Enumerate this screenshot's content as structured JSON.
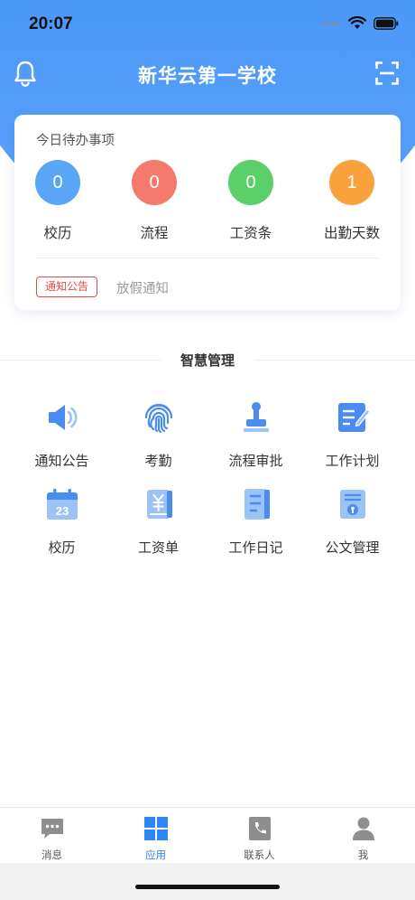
{
  "status_bar": {
    "time": "20:07"
  },
  "header": {
    "title": "新华云第一学校"
  },
  "todo": {
    "title": "今日待办事项",
    "items": [
      {
        "label": "校历",
        "count": "0",
        "color": "#5aa6f6"
      },
      {
        "label": "流程",
        "count": "0",
        "color": "#f57a6e"
      },
      {
        "label": "工资条",
        "count": "0",
        "color": "#5bcf69"
      },
      {
        "label": "出勤天数",
        "count": "1",
        "color": "#f9a13c"
      }
    ],
    "notice_tag": "通知公告",
    "notice_text": "放假通知"
  },
  "section": {
    "title": "智慧管理"
  },
  "apps": [
    {
      "label": "通知公告",
      "icon": "speaker-icon"
    },
    {
      "label": "考勤",
      "icon": "fingerprint-icon"
    },
    {
      "label": "流程审批",
      "icon": "stamp-icon"
    },
    {
      "label": "工作计划",
      "icon": "plan-edit-icon"
    },
    {
      "label": "校历",
      "icon": "calendar-icon",
      "calendar_day": "23"
    },
    {
      "label": "工资单",
      "icon": "salary-book-icon"
    },
    {
      "label": "工作日记",
      "icon": "diary-icon"
    },
    {
      "label": "公文管理",
      "icon": "document-icon"
    }
  ],
  "tabbar": {
    "items": [
      {
        "label": "消息",
        "icon": "message-icon"
      },
      {
        "label": "应用",
        "icon": "apps-grid-icon",
        "active": true
      },
      {
        "label": "联系人",
        "icon": "contacts-phone-icon"
      },
      {
        "label": "我",
        "icon": "user-icon"
      }
    ]
  },
  "colors": {
    "primary": "#3b8af5",
    "icon_blue": "#4a8cf0",
    "tag_red": "#e24b4b",
    "tab_inactive": "#8e8e8e"
  }
}
